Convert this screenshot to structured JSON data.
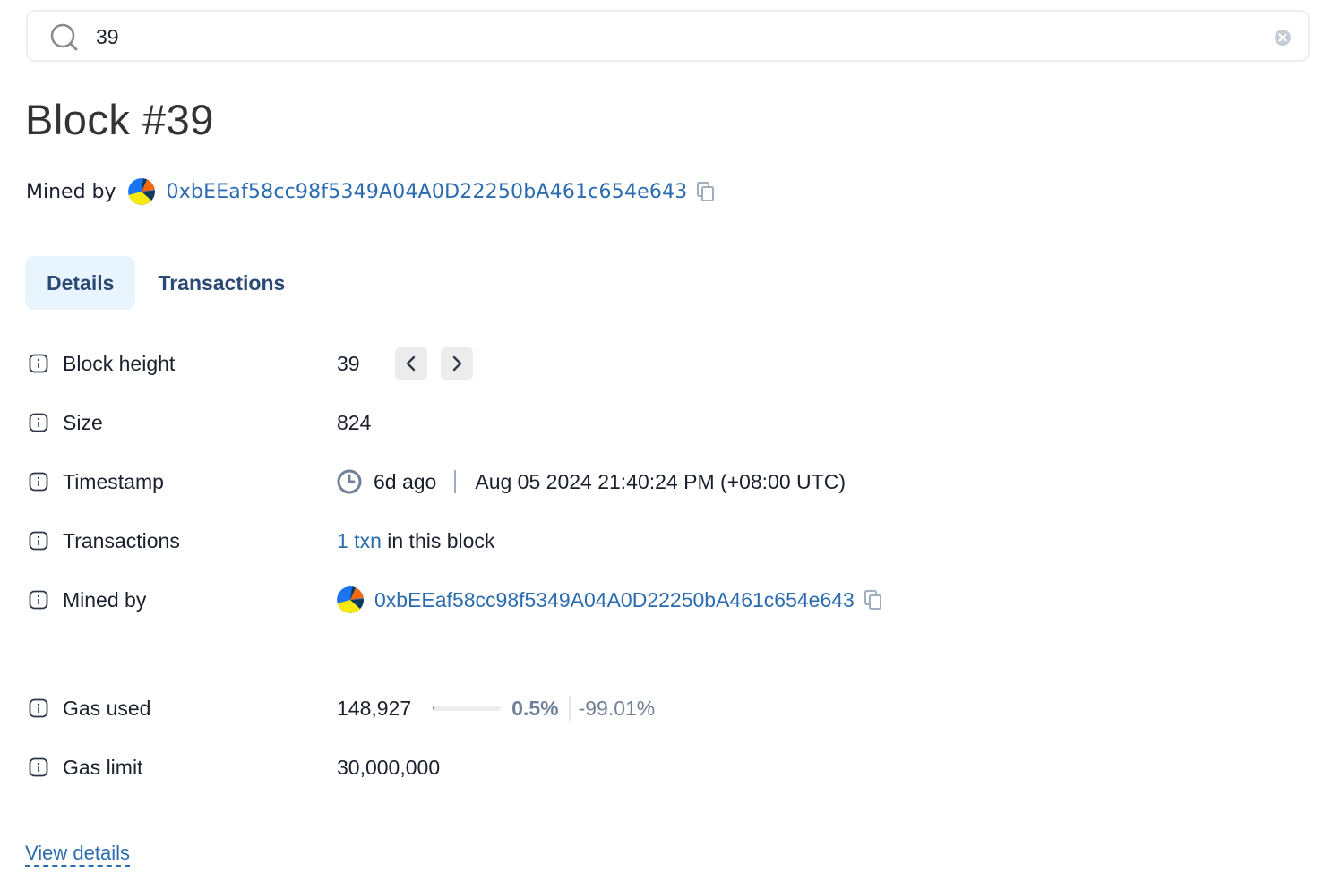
{
  "search": {
    "value": "39",
    "icon": "search-icon",
    "clear_icon": "clear-circle-icon"
  },
  "header": {
    "title": "Block #39",
    "miner_label": "Mined by",
    "miner_address": "0xbEEaf58cc98f5349A04A0D22250bA461c654e643"
  },
  "tabs": [
    {
      "label": "Details",
      "active": true
    },
    {
      "label": "Transactions",
      "active": false
    }
  ],
  "details": {
    "block_height": {
      "label": "Block height",
      "value": "39",
      "prev_icon": "chevron-left-icon",
      "next_icon": "chevron-right-icon"
    },
    "size": {
      "label": "Size",
      "value": "824"
    },
    "timestamp": {
      "label": "Timestamp",
      "relative": "6d ago",
      "absolute": "Aug 05 2024 21:40:24 PM (+08:00 UTC)"
    },
    "transactions": {
      "label": "Transactions",
      "link": "1 txn",
      "suffix": " in this block"
    },
    "mined_by": {
      "label": "Mined by",
      "address": "0xbEEaf58cc98f5349A04A0D22250bA461c654e643"
    },
    "gas_used": {
      "label": "Gas used",
      "value": "148,927",
      "percent_label": "0.5%",
      "percent_value": 0.5,
      "delta": "-99.01%"
    },
    "gas_limit": {
      "label": "Gas limit",
      "value": "30,000,000"
    }
  },
  "footer": {
    "view_details": "View details"
  },
  "colors": {
    "link": "#2b6cb0",
    "tab_active_bg": "#e9f5fe",
    "muted": "#718096",
    "avatar_blue": "#1a73f0",
    "avatar_yellow": "#f7e90c",
    "avatar_orange": "#f26a0d",
    "avatar_navy": "#0d3a5c"
  }
}
